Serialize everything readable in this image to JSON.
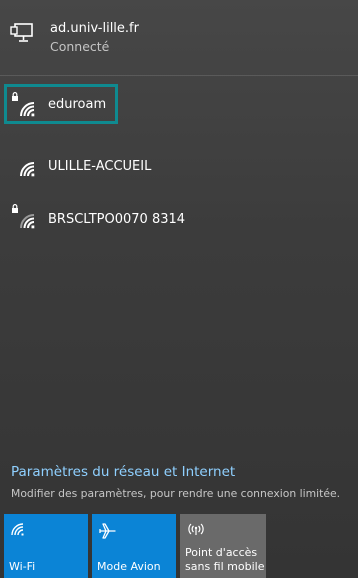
{
  "connection": {
    "name": "ad.univ-lille.fr",
    "status": "Connecté",
    "icon": "network-monitor-icon"
  },
  "networks": [
    {
      "name": "eduroam",
      "secured": true,
      "selected": true
    },
    {
      "name": "ULILLE-ACCUEIL",
      "secured": false,
      "selected": false
    },
    {
      "name": "BRSCLTPO0070 8314",
      "secured": true,
      "selected": false
    }
  ],
  "settings": {
    "title": "Paramètres du réseau et Internet",
    "description": "Modifier des paramètres, pour rendre une connexion limitée."
  },
  "quick_actions": [
    {
      "label": "Wi-Fi",
      "icon": "wifi-icon",
      "active": true
    },
    {
      "label": "Mode Avion",
      "icon": "airplane-icon",
      "active": true
    },
    {
      "label_line1": "Point d'accès",
      "label_line2": "sans fil mobile",
      "icon": "hotspot-icon",
      "active": false
    }
  ],
  "colors": {
    "accent": "#0b84d6",
    "link": "#8fd0ff",
    "selection_border": "#0f8a90",
    "inactive_tile": "#6a6a6a"
  }
}
